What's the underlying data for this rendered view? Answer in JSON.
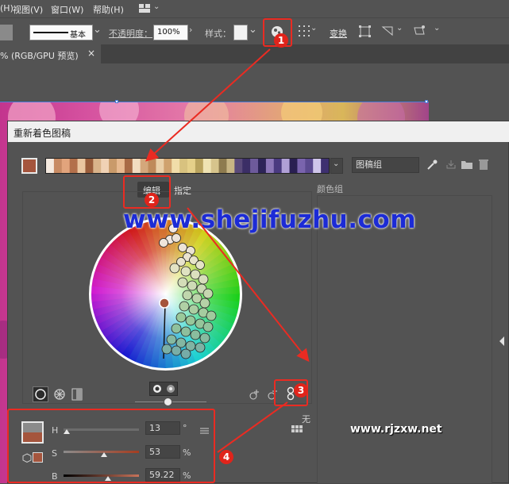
{
  "menubar": {
    "items": [
      "(H)",
      "视图(V)",
      "窗口(W)",
      "帮助(H)"
    ],
    "layout_icon": "workspace-layout-icon"
  },
  "controlbar": {
    "stroke_label": "基本",
    "opacity_label": "不透明度：",
    "opacity_value": "100%",
    "style_label": "样式：",
    "transform_label": "变换"
  },
  "document_tab": {
    "label": "% (RGB/GPU 预览)",
    "close": "×"
  },
  "dialog": {
    "title": "重新着色图稿",
    "group_field": "图稿组",
    "tabs": {
      "edit": "编辑",
      "assign": "指定"
    },
    "color_groups_label": "颜色组",
    "none_label": "无",
    "hsb": {
      "h_label": "H",
      "h_value": "13",
      "h_unit": "°",
      "s_label": "S",
      "s_value": "53",
      "s_unit": "%",
      "b_label": "B",
      "b_value": "59.22",
      "b_unit": "%"
    }
  },
  "watermarks": {
    "main": "www.shejifuzhu.com",
    "secondary": "www.rjzxw.net"
  },
  "annotations": [
    "1",
    "2",
    "3",
    "4"
  ],
  "colors": {
    "annotation_red": "#e0241b",
    "watermark_blue": "#1c2bd6",
    "selected_swatch": "#a5553d"
  }
}
